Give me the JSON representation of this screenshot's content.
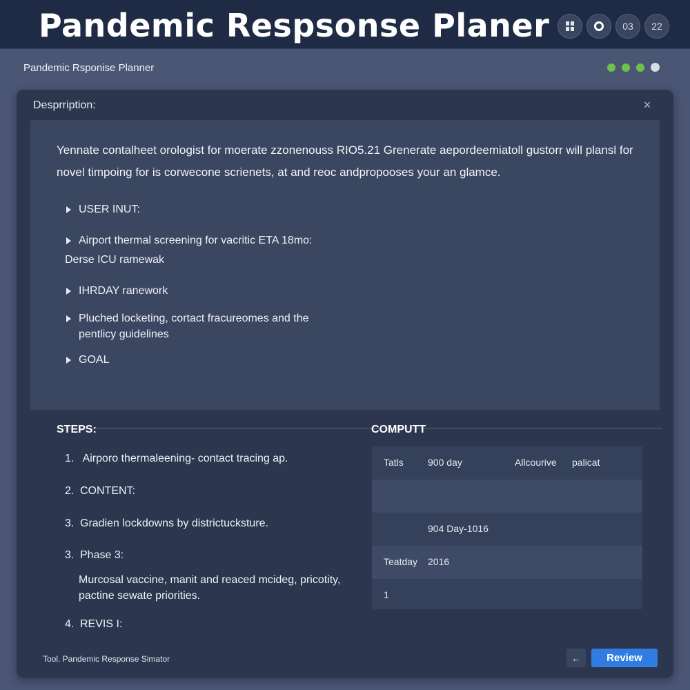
{
  "header": {
    "title": "Pandemic Respsonse Planer",
    "badges": [
      "",
      "",
      "03",
      "22"
    ],
    "badge_icons": [
      "grid-icon",
      "circle-icon"
    ]
  },
  "subheader": {
    "title": "Pandemic Rsponise Planner",
    "status_colors": [
      "#6cc24a",
      "#6cc24a",
      "#6cc24a",
      "#d8dce4"
    ]
  },
  "panel": {
    "label": "Desprription:",
    "close_icon": "×",
    "description": "Yennate contalheet orologist for moerate zzonenouss RIO5.21 Grenerate aepordeemiatoll gustorr will plansl for novel timpoing for is corwecone scrienets, at and reoc andpropooses your an glamce.",
    "bullets": [
      {
        "text": "USER INUT:"
      },
      {
        "text": "Airport thermal screening for vacritic ETA 18mo:",
        "sub": "Derse ICU ramewak"
      },
      {
        "text": "IHRDAY ranework"
      },
      {
        "text": "Pluched locketing, cortact fracureomes and the",
        "sub": "pentlicy guidelines"
      },
      {
        "text": "GOAL"
      }
    ]
  },
  "steps": {
    "title": "STEPS:",
    "items": [
      {
        "num": "1.",
        "text": " Airporo thermaleening- contact tracing ap."
      },
      {
        "num": "2.",
        "text": "CONTENT:"
      },
      {
        "num": "3.",
        "text": "Gradien lockdowns by districtucksture."
      },
      {
        "num": "3.",
        "text": "Phase 3:"
      },
      {
        "num": "4.",
        "text": "REVIS I:"
      }
    ],
    "phase3_detail": "Murcosal vaccine, manit and reaced mcideg, pricotity, pactine sewate priorities."
  },
  "compute": {
    "title": "COMPUTT",
    "rows": [
      [
        "Tatls",
        "900 day",
        "Allcourive",
        "palicat"
      ],
      [
        "",
        "",
        "",
        ""
      ],
      [
        "",
        "904 Day-1016",
        "",
        ""
      ],
      [
        "Teatday",
        "2016",
        "",
        ""
      ],
      [
        "1",
        "",
        "",
        ""
      ]
    ]
  },
  "footer": {
    "tool_label": "Tool. Pandemic Response Simator",
    "back_icon": "←",
    "review_label": "Review"
  },
  "colors": {
    "accent": "#2f7de1",
    "header_bg": "#1f2a44",
    "panel_bg": "#2c364f",
    "page_bg": "#4b5675"
  }
}
